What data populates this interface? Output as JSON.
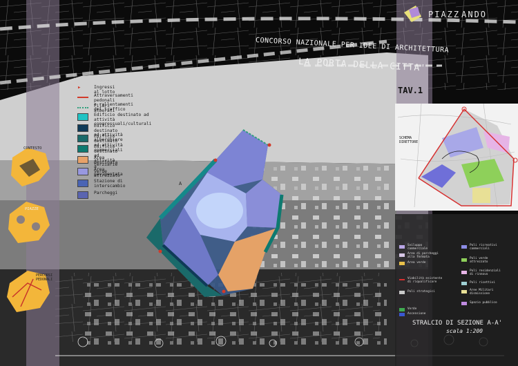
{
  "header": {
    "logo_text": "PIAZZ",
    "logo_text2": "ANDO",
    "competition": "CONCORSO NAZIONALE PER IDEE DI ARCHITETTURA",
    "project_title": "LA PORTA DELLA CITTA'",
    "sheet": "TAV.1"
  },
  "legend": {
    "items": [
      {
        "label": "Ingressi al lotto",
        "color": "#d23a2a"
      },
      {
        "label": "Attraversamenti pedonali\ne rallentamenti del traffico",
        "color": "#d23a2a"
      },
      {
        "label": "Filari alberati",
        "color": "#2fa07d"
      },
      {
        "label": "Edificio destinato ad attività\ncongressuali/culturali",
        "color": "#1fc3c4"
      },
      {
        "label": "Edificio destinato ad attività\nalberghiere",
        "color": "#0f3a58"
      },
      {
        "label": "Edificio destinato ad attività\ncommerciali",
        "color": "#1a6a6a"
      },
      {
        "label": "Edificio destinato ad attività\nterziarie",
        "color": "#0e7a70"
      },
      {
        "label": "Area destinata a\nverde attrezzato",
        "color": "#e7a26a"
      },
      {
        "label": "Area pavimentata",
        "color": "#9898e0"
      },
      {
        "label": "Stazione di interscambio",
        "color": "#4a64b4"
      },
      {
        "label": "Parcheggi",
        "color": "#5a64b0"
      }
    ]
  },
  "side_panels": {
    "p1": "CONTESTO",
    "p2": "PIAZZE",
    "p3": "PERCORSI PEDONALI"
  },
  "inset": {
    "title": "SCHEMA DIRETTORE"
  },
  "right_legend": {
    "col1": [
      {
        "label": "Sviluppo\ncommerciale",
        "color": "#b9a5e6"
      },
      {
        "label": "Area di parcheggi\nalla fermata",
        "color": "#d7c7e6"
      },
      {
        "label": "Area verde",
        "color": "#e8c04a"
      },
      {
        "label": "Viabilità esistente\ndi riqualificare",
        "color": "#d73030"
      },
      {
        "label": "Poli strategici",
        "color": "#c9c9c9"
      },
      {
        "label": "Verde",
        "color": "#3faa50"
      },
      {
        "label": "Ascensione",
        "color": "#3a58d0"
      }
    ],
    "col2": [
      {
        "label": "Poli ricreativi\ncommerciali",
        "color": "#8c8ce6"
      },
      {
        "label": "Poli verde\nattrezzato",
        "color": "#8ed05a"
      },
      {
        "label": "Poli residenziali\ndi rinnovo",
        "color": "#e6b4e6"
      },
      {
        "label": "Poli ricettivi",
        "color": "#9fd0d4"
      },
      {
        "label": "Aree Militari\ndismissione",
        "color": "#e8e096"
      },
      {
        "label": "Spazio pubblico",
        "color": "#c08be0"
      }
    ]
  },
  "section": {
    "title": "STRALCIO DI SEZIONE A-A'",
    "scale": "scala 1:200"
  },
  "label_A": "A"
}
